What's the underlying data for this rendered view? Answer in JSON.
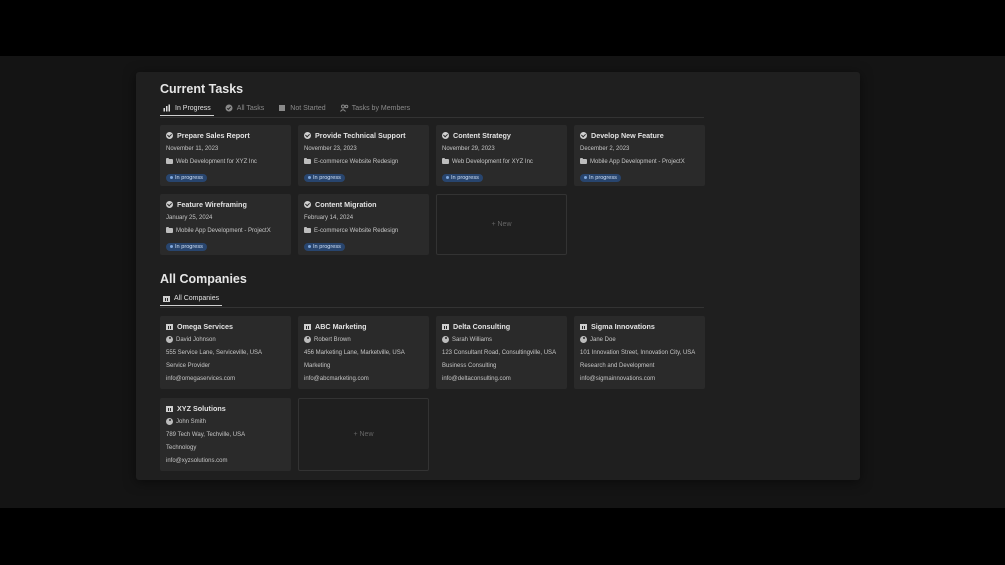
{
  "current_tasks": {
    "title": "Current Tasks",
    "tabs": [
      {
        "label": "In Progress",
        "icon": "bar-chart-icon",
        "active": true
      },
      {
        "label": "All Tasks",
        "icon": "check-circle-icon",
        "active": false
      },
      {
        "label": "Not Started",
        "icon": "square-icon",
        "active": false
      },
      {
        "label": "Tasks by Members",
        "icon": "people-icon",
        "active": false
      }
    ],
    "cards": [
      {
        "title": "Prepare Sales Report",
        "date": "November 11, 2023",
        "project": "Web Development for XYZ Inc",
        "status": "In progress"
      },
      {
        "title": "Provide Technical Support",
        "date": "November 23, 2023",
        "project": "E-commerce Website Redesign",
        "status": "In progress"
      },
      {
        "title": "Content Strategy",
        "date": "November 29, 2023",
        "project": "Web Development for XYZ Inc",
        "status": "In progress"
      },
      {
        "title": "Develop New Feature",
        "date": "December 2, 2023",
        "project": "Mobile App Development - ProjectX",
        "status": "In progress"
      },
      {
        "title": "Feature Wireframing",
        "date": "January 25, 2024",
        "project": "Mobile App Development - ProjectX",
        "status": "In progress"
      },
      {
        "title": "Content Migration",
        "date": "February 14, 2024",
        "project": "E-commerce Website Redesign",
        "status": "In progress"
      }
    ],
    "new_label": "+ New"
  },
  "all_companies": {
    "title": "All Companies",
    "tabs": [
      {
        "label": "All Companies",
        "icon": "building-icon",
        "active": true
      }
    ],
    "cards": [
      {
        "name": "Omega Services",
        "contact": "David Johnson",
        "address": "555 Service Lane, Serviceville, USA",
        "industry": "Service Provider",
        "email": "info@omegaservices.com"
      },
      {
        "name": "ABC Marketing",
        "contact": "Robert Brown",
        "address": "456 Marketing Lane, Marketville, USA",
        "industry": "Marketing",
        "email": "info@abcmarketing.com"
      },
      {
        "name": "Delta Consulting",
        "contact": "Sarah Williams",
        "address": "123 Consultant Road, Consultingville, USA",
        "industry": "Business Consulting",
        "email": "info@deltaconsulting.com"
      },
      {
        "name": "Sigma Innovations",
        "contact": "Jane Doe",
        "address": "101 Innovation Street, Innovation City, USA",
        "industry": "Research and Development",
        "email": "info@sigmainnovations.com"
      },
      {
        "name": "XYZ Solutions",
        "contact": "John Smith",
        "address": "789 Tech Way, Techville, USA",
        "industry": "Technology",
        "email": "info@xyzsolutions.com"
      }
    ],
    "new_label": "+ New"
  },
  "colors": {
    "background": "#000000",
    "panel": "#1f1f1f",
    "card": "#2a2a2a",
    "badge": "#28456e"
  }
}
